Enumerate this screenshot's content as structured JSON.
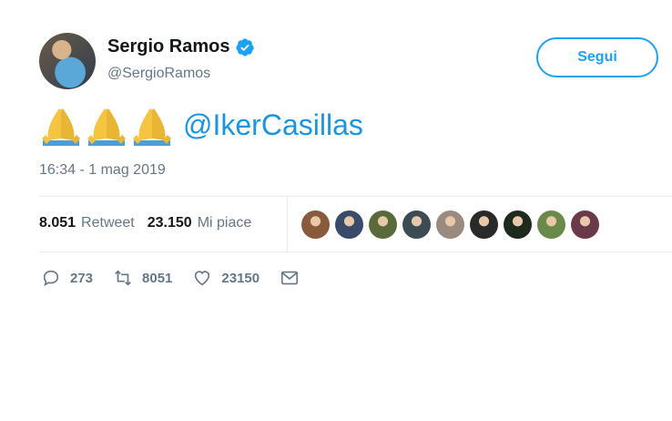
{
  "author": {
    "name": "Sergio Ramos",
    "handle": "@SergioRamos",
    "verified": true
  },
  "follow_button": {
    "label": "Segui"
  },
  "tweet": {
    "emoji": [
      "🙏",
      "🙏",
      "🙏"
    ],
    "mention": "@IkerCasillas",
    "timestamp": "16:34 - 1 mag 2019"
  },
  "stats": {
    "retweets_count": "8.051",
    "retweets_label": "Retweet",
    "likes_count": "23.150",
    "likes_label": "Mi piace"
  },
  "likers": [
    {
      "color": "#8a5a3c"
    },
    {
      "color": "#3a4a6a"
    },
    {
      "color": "#5a6a3a"
    },
    {
      "color": "#3d4b55"
    },
    {
      "color": "#9a8a80"
    },
    {
      "color": "#2a2a2a"
    },
    {
      "color": "#1f2a1f"
    },
    {
      "color": "#6a8a4a"
    },
    {
      "color": "#6a3a4a"
    }
  ],
  "actions": {
    "replies": "273",
    "retweets": "8051",
    "likes": "23150"
  },
  "colors": {
    "accent": "#1da1f2",
    "mention": "#1b95e0",
    "muted": "#657786"
  }
}
